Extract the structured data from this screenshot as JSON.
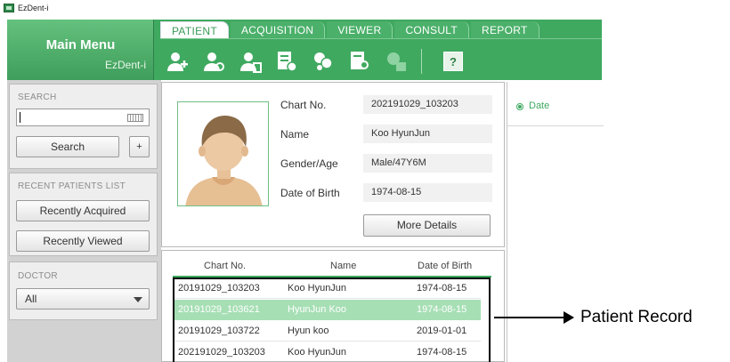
{
  "window": {
    "title": "EzDent-i"
  },
  "main_menu": {
    "title": "Main Menu",
    "subtitle": "EzDent-i"
  },
  "tabs": [
    {
      "label": "PATIENT",
      "active": true
    },
    {
      "label": "ACQUISITION",
      "active": false
    },
    {
      "label": "VIEWER",
      "active": false
    },
    {
      "label": "CONSULT",
      "active": false
    },
    {
      "label": "REPORT",
      "active": false
    }
  ],
  "toolbar": {
    "icons": [
      "add-patient-icon",
      "edit-patient-icon",
      "delete-patient-icon",
      "import-record-icon",
      "merge-patients-icon",
      "search-record-icon",
      "save-icon",
      "help-icon"
    ],
    "help_label": "?"
  },
  "search": {
    "section_label": "SEARCH",
    "input_value": "",
    "search_button": "Search",
    "plus_button": "+"
  },
  "recent": {
    "section_label": "RECENT PATIENTS LIST",
    "recently_acquired": "Recently Acquired",
    "recently_viewed": "Recently Viewed"
  },
  "doctor": {
    "section_label": "DOCTOR",
    "selected": "All"
  },
  "patient_info": {
    "chart_no_label": "Chart No.",
    "chart_no": "202191029_103203",
    "name_label": "Name",
    "name": "Koo HyunJun",
    "gender_age_label": "Gender/Age",
    "gender_age": "Male/47Y6M",
    "dob_label": "Date of Birth",
    "dob": "1974-08-15",
    "more_details": "More Details"
  },
  "date_panel": {
    "label": "Date"
  },
  "patient_list": {
    "headers": [
      "Chart No.",
      "Name",
      "Date of Birth"
    ],
    "rows": [
      {
        "chart_no": "20191029_103203",
        "name": "Koo HyunJun",
        "dob": "1974-08-15",
        "selected": false
      },
      {
        "chart_no": "20191029_103621",
        "name": "HyunJun Koo",
        "dob": "1974-08-15",
        "selected": true
      },
      {
        "chart_no": "20191029_103722",
        "name": "Hyun koo",
        "dob": "2019-01-01",
        "selected": false
      },
      {
        "chart_no": "202191029_103203",
        "name": "Koo HyunJun",
        "dob": "1974-08-15",
        "selected": false
      }
    ]
  },
  "annotation": {
    "label": "Patient Record"
  },
  "colors": {
    "brand_green": "#3fa960",
    "selected_row": "#a7dfb5"
  }
}
